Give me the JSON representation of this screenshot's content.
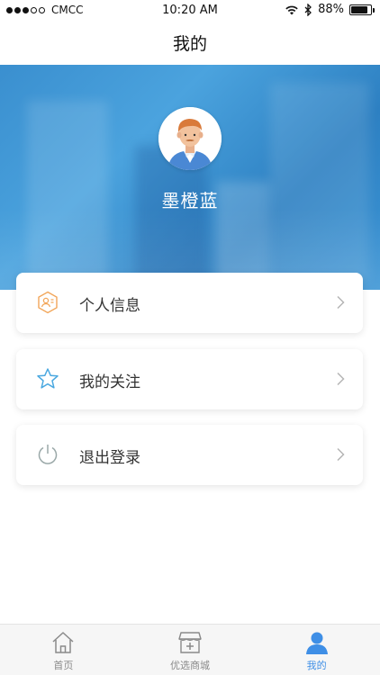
{
  "status_bar": {
    "carrier": "CMCC",
    "time": "10:20 AM",
    "battery": "88%",
    "battery_level": 0.88,
    "signal_dots_filled": 3,
    "signal_dots_total": 5
  },
  "nav": {
    "title": "我的"
  },
  "profile": {
    "name": "墨橙蓝"
  },
  "menu": [
    {
      "label": "个人信息",
      "icon": "user-hexagon-icon",
      "color": "#f2a65a"
    },
    {
      "label": "我的关注",
      "icon": "star-icon",
      "color": "#4aa8e0"
    },
    {
      "label": "退出登录",
      "icon": "power-icon",
      "color": "#9aa8a8"
    }
  ],
  "tabs": [
    {
      "label": "首页",
      "icon": "home-icon",
      "active": false
    },
    {
      "label": "优选商城",
      "icon": "shop-icon",
      "active": false
    },
    {
      "label": "我的",
      "icon": "user-icon",
      "active": true
    }
  ],
  "colors": {
    "accent": "#3f8fe6",
    "hero_blue": "#3a8fcf",
    "tab_inactive": "#8a8a8a"
  }
}
